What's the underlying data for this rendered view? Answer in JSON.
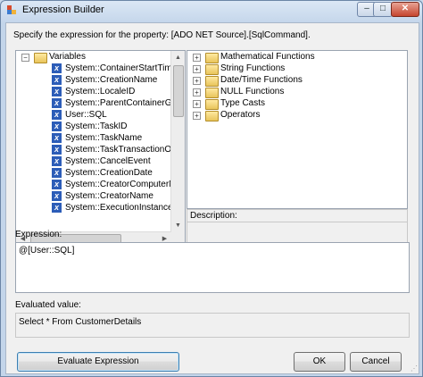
{
  "window": {
    "title": "Expression Builder"
  },
  "prompt": "Specify the expression for the property: [ADO NET Source].[SqlCommand].",
  "variables_tree": {
    "root": "Variables",
    "items": [
      "System::ContainerStartTime",
      "System::CreationName",
      "System::LocaleID",
      "System::ParentContainerGUID",
      "User::SQL",
      "System::TaskID",
      "System::TaskName",
      "System::TaskTransactionOptio",
      "System::CancelEvent",
      "System::CreationDate",
      "System::CreatorComputerName",
      "System::CreatorName",
      "System::ExecutionInstanceGUI"
    ]
  },
  "functions_tree": {
    "items": [
      "Mathematical Functions",
      "String Functions",
      "Date/Time Functions",
      "NULL Functions",
      "Type Casts",
      "Operators"
    ]
  },
  "description": {
    "label": "Description:"
  },
  "expression": {
    "label": "Expression:",
    "value": "@[User::SQL]"
  },
  "evaluated": {
    "label": "Evaluated value:",
    "value": "Select * From CustomerDetails"
  },
  "buttons": {
    "evaluate": "Evaluate Expression",
    "ok": "OK",
    "cancel": "Cancel"
  },
  "controls": {
    "minimize": "–",
    "maximize": "□",
    "close": "✕"
  },
  "colors": {
    "accent": "#3c7fb1",
    "variable_icon": "#2c5db8",
    "folder": "#e8c45a"
  }
}
